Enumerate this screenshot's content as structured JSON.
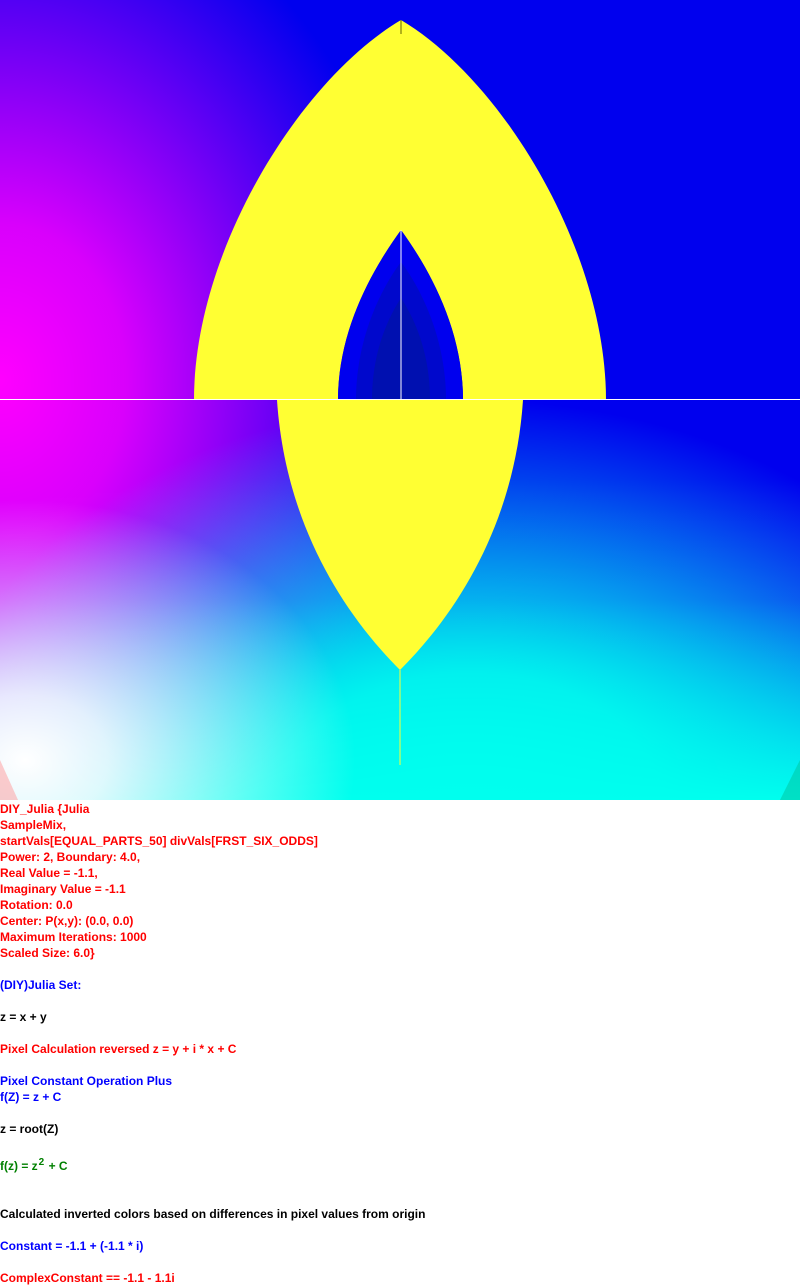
{
  "fractal": {
    "colors": {
      "magenta": "#ff00ff",
      "blue": "#0000ee",
      "cyan": "#00ffee",
      "yellow": "#ffff33",
      "white": "#ffffff"
    }
  },
  "info": {
    "header": {
      "l1": "DIY_Julia {Julia",
      "l2": "SampleMix,",
      "l3": "startVals[EQUAL_PARTS_50] divVals[FRST_SIX_ODDS]",
      "l4": "Power: 2, Boundary: 4.0,",
      "l5": "Real Value = -1.1,",
      "l6": "Imaginary Value = -1.1",
      "l7": "Rotation: 0.0",
      "l8": "Center: P(x,y): (0.0, 0.0)",
      "l9": "Maximum Iterations: 1000",
      "l10": "Scaled Size: 6.0}"
    },
    "set_title": "(DIY)Julia Set:",
    "z_def": "z = x + y",
    "pixel_calc": "Pixel Calculation reversed z = y + i * x + C",
    "const_op": "Pixel Constant Operation Plus",
    "f_Z": "f(Z) = z + C",
    "z_root": "z = root(Z)",
    "fz": {
      "pre": "f(z) = z",
      "power": "2",
      "post": " + C"
    },
    "colors_note": "Calculated inverted colors based on differences in pixel values from origin",
    "constant": "Constant = -1.1 + (-1.1 * i)",
    "complex_constant": "ComplexConstant == -1.1 - 1.1i"
  }
}
